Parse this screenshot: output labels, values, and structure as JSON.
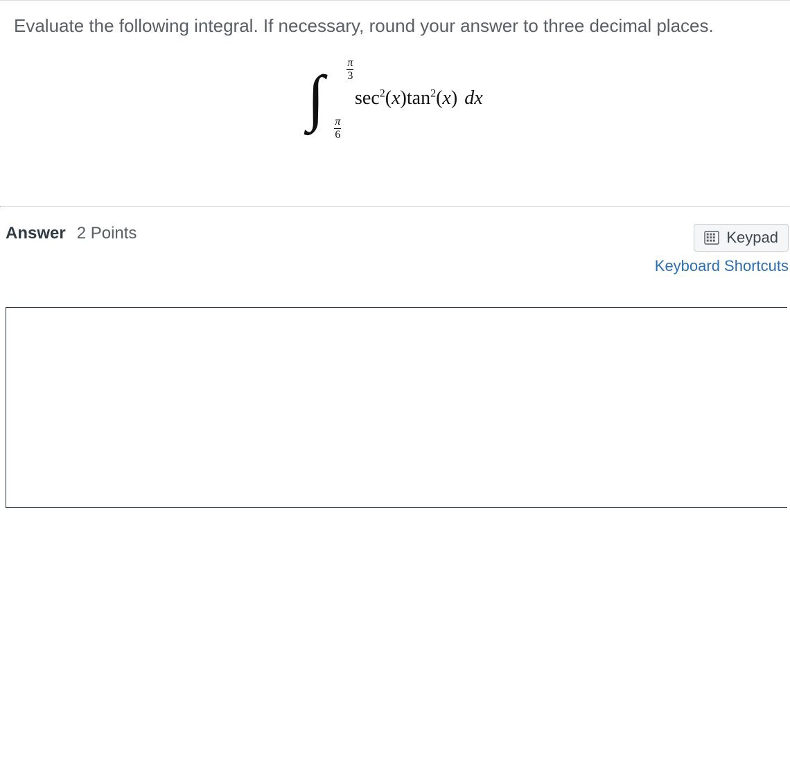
{
  "question": {
    "prompt": "Evaluate the following integral. If necessary, round your answer to three decimal places.",
    "integral": {
      "lower_limit": {
        "numerator": "π",
        "denominator": "6"
      },
      "upper_limit": {
        "numerator": "π",
        "denominator": "3"
      },
      "integrand_html": "sec²(x)tan²(x) dx",
      "fn1": "sec",
      "exp1": "2",
      "var1": "x",
      "fn2": "tan",
      "exp2": "2",
      "var2": "x",
      "dx": "dx"
    }
  },
  "answer_section": {
    "label": "Answer",
    "points": "2 Points",
    "keypad_button": "Keypad",
    "shortcuts_link": "Keyboard Shortcuts",
    "input_value": ""
  },
  "colors": {
    "link": "#2a6fb5",
    "text_muted": "#5a5f66",
    "border": "#222b33"
  }
}
